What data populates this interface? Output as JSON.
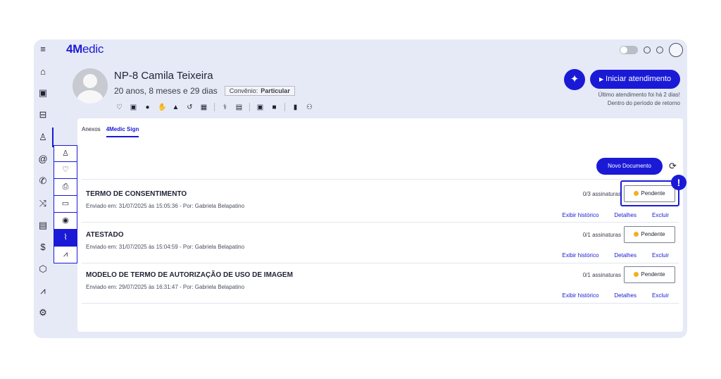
{
  "app": {
    "logo_bold": "4M",
    "logo_rest": "edic"
  },
  "rail_icons": [
    "menu-icon",
    "home-icon",
    "calendar-icon",
    "sofa-icon",
    "user-icon",
    "at-icon",
    "phone-icon",
    "shuffle-icon",
    "clipboard-icon",
    "dollar-icon",
    "cube-icon",
    "chart-icon",
    "gear-icon"
  ],
  "rail_glyphs": [
    "≡",
    "⌂",
    "▣",
    "⊟",
    "♙",
    "@",
    "✆",
    "⤨",
    "▤",
    "$",
    "⬡",
    "⩘",
    "⚙"
  ],
  "patient": {
    "name": "NP-8 Camila Teixeira",
    "age": "20 anos, 8 meses e 29 dias",
    "convenio_label": "Convênio:",
    "convenio_value": "Particular"
  },
  "header": {
    "start_button": "Iniciar atendimento",
    "last_visit": "Último atendimento foi há 2 dias!",
    "return_period": "Dentro do período de retorno"
  },
  "tabs": [
    {
      "label": "Anexos",
      "active": false
    },
    {
      "label": "4Medic Sign",
      "active": true
    }
  ],
  "new_document": "Novo Documento",
  "documents": [
    {
      "title": "TERMO DE CONSENTIMENTO",
      "sent": "Enviado em: 31/07/2025 às 15:05:36 - Por: Gabriela Belapatino",
      "signatures": "0/3 assinaturas",
      "status": "Pendente"
    },
    {
      "title": "ATESTADO",
      "sent": "Enviado em: 31/07/2025 às 15:04:59 - Por: Gabriela Belapatino",
      "signatures": "0/1 assinaturas",
      "status": "Pendente"
    },
    {
      "title": "MODELO DE TERMO DE AUTORIZAÇÃO DE USO DE IMAGEM",
      "sent": "Enviado em: 29/07/2025 às 16:31:47 - Por: Gabriela Belapatino",
      "signatures": "0/1 assinaturas",
      "status": "Pendente"
    }
  ],
  "doc_actions": {
    "history": "Exibir histórico",
    "details": "Detalhes",
    "delete": "Excluir"
  },
  "alert_symbol": "!",
  "colors": {
    "primary": "#1a1ad6",
    "background": "#e6eaf7",
    "pending": "#f2b01e"
  }
}
